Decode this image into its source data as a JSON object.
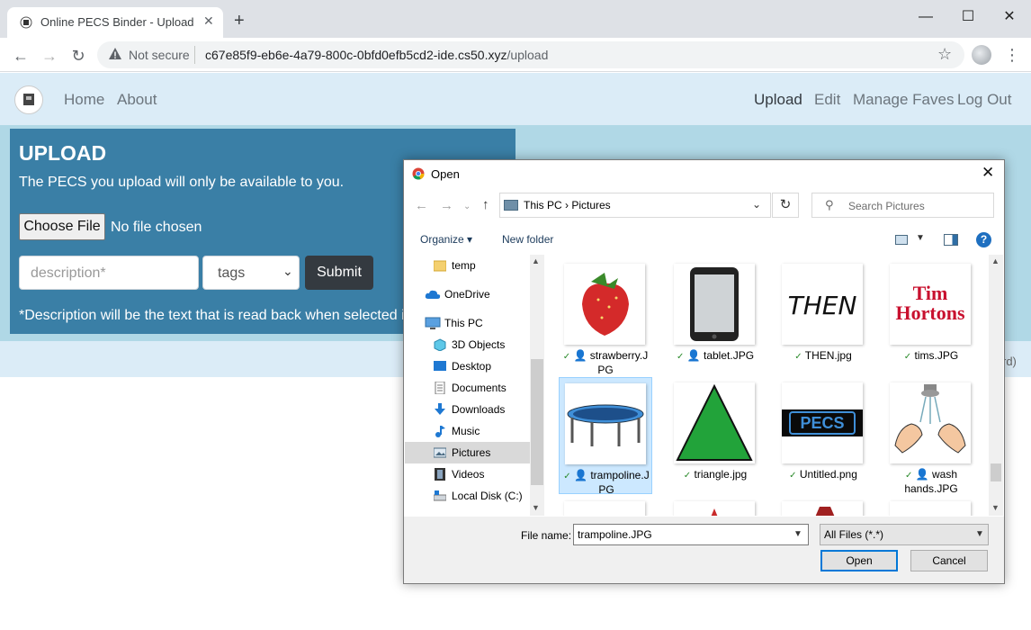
{
  "browser": {
    "tab_title": "Online PECS Binder - Upload",
    "tab_close": "✕",
    "new_tab": "+",
    "minimize": "—",
    "maximize": "☐",
    "close": "✕",
    "not_secure": "Not secure",
    "url_host": "c67e85f9-eb6e-4a79-800c-0bfd0efb5cd2-ide.cs50.xyz",
    "url_path": "/upload",
    "back": "←",
    "forward": "→",
    "reload": "↻",
    "star": "☆",
    "menu": "⋮"
  },
  "site": {
    "nav_left": [
      "Home",
      "About"
    ],
    "nav_right": [
      "Upload",
      "Edit",
      "Manage Faves",
      "Log Out"
    ],
    "active": "Upload",
    "partial_text": "rd)"
  },
  "upload": {
    "title": "UPLOAD",
    "subtitle": "The PECS you upload will only be available to you.",
    "choose_file": "Choose File",
    "no_file": "No file chosen",
    "description_placeholder": "description*",
    "tags_label": "tags",
    "submit": "Submit",
    "note": "*Description will be the text that is read back when selected i"
  },
  "dialog": {
    "title": "Open",
    "close": "✕",
    "address": "This PC  ›  Pictures",
    "search_placeholder": "Search Pictures",
    "organize": "Organize ▾",
    "new_folder": "New folder",
    "help": "?",
    "tree": [
      {
        "label": "temp",
        "icon": "folder-icon",
        "selected": false
      },
      {
        "label": "OneDrive",
        "icon": "cloud-icon",
        "selected": false
      },
      {
        "label": "This PC",
        "icon": "computer-icon",
        "selected": false
      },
      {
        "label": "3D Objects",
        "icon": "cube-icon",
        "selected": false
      },
      {
        "label": "Desktop",
        "icon": "desktop-icon",
        "selected": false
      },
      {
        "label": "Documents",
        "icon": "document-icon",
        "selected": false
      },
      {
        "label": "Downloads",
        "icon": "download-icon",
        "selected": false
      },
      {
        "label": "Music",
        "icon": "music-icon",
        "selected": false
      },
      {
        "label": "Pictures",
        "icon": "pictures-icon",
        "selected": true
      },
      {
        "label": "Videos",
        "icon": "film-icon",
        "selected": false
      },
      {
        "label": "Local Disk (C:)",
        "icon": "disk-icon",
        "selected": false
      }
    ],
    "files": [
      {
        "line1": "strawberry.J",
        "line2": "PG",
        "user": true,
        "thumb": "strawberry",
        "selected": false
      },
      {
        "line1": "tablet.JPG",
        "line2": "",
        "user": true,
        "thumb": "tablet",
        "selected": false
      },
      {
        "line1": "THEN.jpg",
        "line2": "",
        "user": false,
        "thumb": "then",
        "selected": false
      },
      {
        "line1": "tims.JPG",
        "line2": "",
        "user": false,
        "thumb": "tims",
        "selected": false
      },
      {
        "line1": "trampoline.J",
        "line2": "PG",
        "user": true,
        "thumb": "trampoline",
        "selected": true
      },
      {
        "line1": "triangle.jpg",
        "line2": "",
        "user": false,
        "thumb": "triangle",
        "selected": false
      },
      {
        "line1": "Untitled.png",
        "line2": "",
        "user": false,
        "thumb": "pecs",
        "selected": false
      },
      {
        "line1": "wash",
        "line2": "hands.JPG",
        "user": true,
        "thumb": "wash",
        "selected": false
      }
    ],
    "then_text": "THEN",
    "tims_line1": "Tim",
    "tims_line2": "Hortons",
    "pecs_text": "PECS",
    "file_name_label": "File name:",
    "file_name_value": "trampoline.JPG",
    "filter_value": "All Files (*.*)",
    "open": "Open",
    "cancel": "Cancel"
  },
  "colors": {
    "card": "#3a7fa6",
    "band": "#b0d8e6",
    "nav_bg": "#dbecf7",
    "selection": "#cce8ff"
  }
}
